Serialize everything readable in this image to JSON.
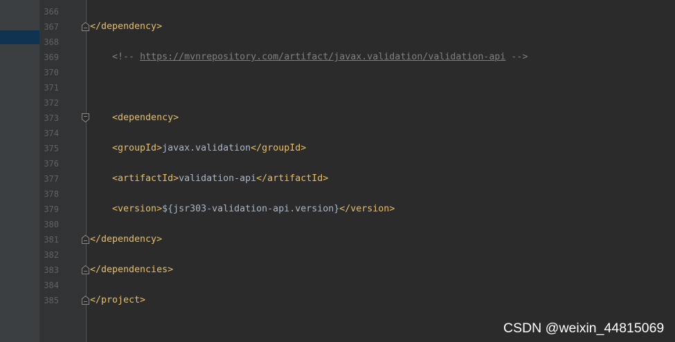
{
  "colors": {
    "editor_bg": "#2b2b2b",
    "gutter_bg": "#313335",
    "sidebar_bg": "#3c3f41",
    "selection": "#0f3350",
    "line_number": "#606366",
    "xml_tag": "#e8bf6a",
    "text": "#a9b7c6",
    "comment": "#808080",
    "watermark": "#ffffff"
  },
  "editor": {
    "lines": [
      {
        "number": "366"
      },
      {
        "number": "367",
        "code": [
          "</dependency>"
        ]
      },
      {
        "number": "368"
      },
      {
        "number": "369",
        "code": [
          "    <!-- ",
          "https://mvnrepository.com/artifact/javax.validation/validation-api",
          " -->"
        ]
      },
      {
        "number": "370"
      },
      {
        "number": "371"
      },
      {
        "number": "372"
      },
      {
        "number": "373",
        "code": [
          "    <dependency>"
        ]
      },
      {
        "number": "374"
      },
      {
        "number": "375",
        "code": [
          "    <groupId>",
          "javax.validation",
          "</groupId>"
        ]
      },
      {
        "number": "376"
      },
      {
        "number": "377",
        "code": [
          "    <artifactId>",
          "validation-api",
          "</artifactId>"
        ]
      },
      {
        "number": "378"
      },
      {
        "number": "379",
        "code": [
          "    <version>",
          "${jsr303-validation-api.version}",
          "</version>"
        ]
      },
      {
        "number": "380"
      },
      {
        "number": "381",
        "code": [
          "</dependency>"
        ]
      },
      {
        "number": "382"
      },
      {
        "number": "383",
        "code": [
          "</dependencies>"
        ]
      },
      {
        "number": "384"
      },
      {
        "number": "385",
        "code": [
          "</project>"
        ]
      }
    ]
  },
  "watermark": "CSDN @weixin_44815069"
}
